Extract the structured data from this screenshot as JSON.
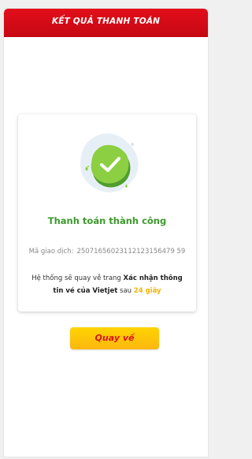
{
  "header": {
    "title": "KẾT QUẢ THANH TOÁN"
  },
  "result": {
    "status_title": "Thanh toán thành công",
    "transaction_label": "Mã giao dịch:",
    "transaction_code": "25071656023112123156479 59",
    "redirect_prefix": "Hệ thống sẽ quay về trang",
    "redirect_page": "Xác nhận thông tin vé của Vietjet",
    "redirect_mid": "sau",
    "redirect_seconds": "24 giây"
  },
  "actions": {
    "back_label": "Quay về"
  },
  "colors": {
    "header_red": "#d90c17",
    "success_green": "#3c9a2b",
    "accent_yellow": "#fbc02d"
  },
  "icons": {
    "status": "success-check-icon"
  }
}
